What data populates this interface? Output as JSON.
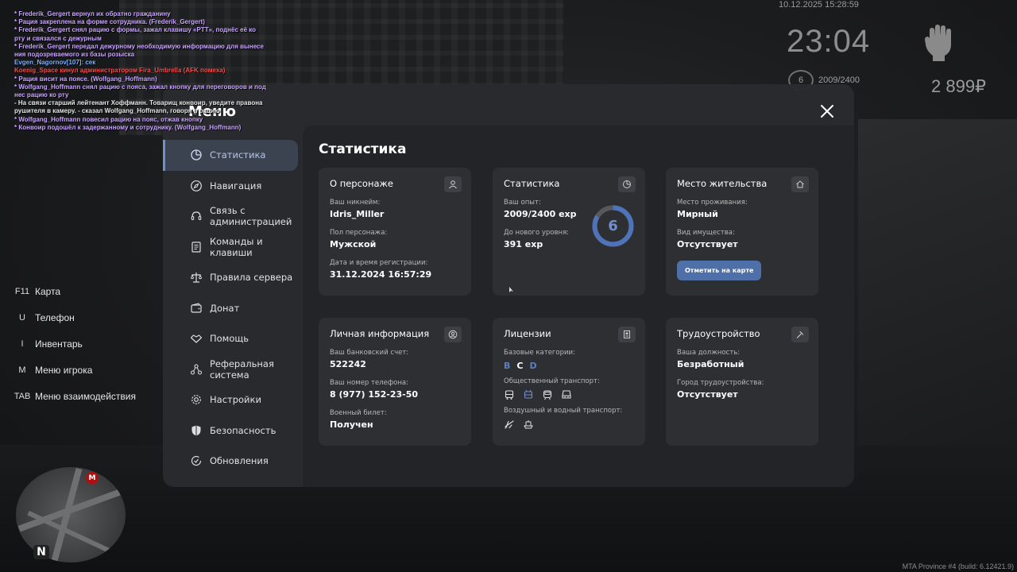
{
  "hud": {
    "date": "10.12.2025 15:28:59",
    "time": "23:04",
    "level": "6",
    "exp": "2009/2400",
    "money": "2 899₽"
  },
  "chat": [
    {
      "text": "* Frederik_Gergert вернул их обратно гражданину",
      "color": "purple"
    },
    {
      "text": "* Рация закреплена на форме сотрудника. (Frederik_Gergert)",
      "color": "purple"
    },
    {
      "text": "* Frederik_Gergert снял рацию с формы, зажал клавишу «PTT», поднёс её ко",
      "color": "purple"
    },
    {
      "text": "рту и связался с дежурным",
      "color": "purple"
    },
    {
      "text": "* Frederik_Gergert передал дежурному необходимую информацию для вынесе",
      "color": "purple"
    },
    {
      "text": "ния подозреваемого из базы розыска",
      "color": "purple"
    },
    {
      "text": "Evgen_Nagornov[107]: сек",
      "color": "blue"
    },
    {
      "text": "Koenig_Space кинул администратором Fira_Umbrella (AFK помеха)",
      "color": "red"
    },
    {
      "text": "* Рация висит на поясе. (Wolfgang_Hoffmann)",
      "color": "purple"
    },
    {
      "text": "* Wolfgang_Hoffmann снял рацию с пояса, зажал кнопку для переговоров и под",
      "color": "purple"
    },
    {
      "text": "нес рацию ко рту",
      "color": "purple"
    },
    {
      "text": "- На связи старший лейтенант Хоффманн. Товарищ конвоир, уведите правона",
      "color": "white"
    },
    {
      "text": "рушителя в камеру. - сказал Wolfgang_Hoffmann, говоря в рацию",
      "color": "white"
    },
    {
      "text": "* Wolfgang_Hoffmann повесил рацию на пояс, отжав кнопку",
      "color": "purple"
    },
    {
      "text": "* Конвоир подошёл к задержанному и сотруднику. (Wolfgang_Hoffmann)",
      "color": "purple"
    }
  ],
  "hotkeys": [
    {
      "key": "F11",
      "label": "Карта"
    },
    {
      "key": "U",
      "label": "Телефон"
    },
    {
      "key": "I",
      "label": "Инвентарь"
    },
    {
      "key": "M",
      "label": "Меню игрока"
    },
    {
      "key": "TAB",
      "label": "Меню взаимодействия"
    }
  ],
  "minimap": {
    "north": "N",
    "marker": "M"
  },
  "footer": "MTA Province #4 (build: 6.12421.9)",
  "menu": {
    "title": "Меню",
    "nav": [
      {
        "label": "Статистика",
        "icon": "pie-chart-icon",
        "active": true
      },
      {
        "label": "Навигация",
        "icon": "compass-icon"
      },
      {
        "label": "Связь с администрацией",
        "icon": "headset-icon"
      },
      {
        "label": "Команды и клавиши",
        "icon": "document-icon"
      },
      {
        "label": "Правила сервера",
        "icon": "scales-icon"
      },
      {
        "label": "Донат",
        "icon": "wallet-icon"
      },
      {
        "label": "Помощь",
        "icon": "handshake-icon"
      },
      {
        "label": "Реферальная система",
        "icon": "referral-icon"
      },
      {
        "label": "Настройки",
        "icon": "gear-icon"
      },
      {
        "label": "Безопасность",
        "icon": "shield-icon"
      },
      {
        "label": "Обновления",
        "icon": "update-icon"
      }
    ],
    "content_title": "Статистика",
    "cards": {
      "character": {
        "title": "О персонаже",
        "nickname_label": "Ваш никнейм:",
        "nickname": "Idris_Miller",
        "gender_label": "Пол персонажа:",
        "gender": "Мужской",
        "reg_label": "Дата и время регистрации:",
        "reg": "31.12.2024 16:57:29"
      },
      "stats": {
        "title": "Статистика",
        "exp_label": "Ваш опыт:",
        "exp": "2009/2400 exp",
        "next_label": "До нового уровня:",
        "next": "391 exp",
        "level": "6",
        "progress": 0.837
      },
      "residence": {
        "title": "Место жительства",
        "place_label": "Место проживания:",
        "place": "Мирный",
        "property_label": "Вид имущества:",
        "property": "Отсутствует",
        "button": "Отметить на карте"
      },
      "personal": {
        "title": "Личная информация",
        "bank_label": "Ваш банковский счет:",
        "bank": "522242",
        "phone_label": "Ваш номер телефона:",
        "phone": "8 (977) 152-23-50",
        "military_label": "Военный билет:",
        "military": "Получен"
      },
      "licenses": {
        "title": "Лицензии",
        "base_label": "Базовые категории:",
        "cat_b": "B",
        "cat_c": "C",
        "cat_d": "D",
        "public_label": "Общественный транспорт:",
        "air_label": "Воздушный и водный транспорт:"
      },
      "employment": {
        "title": "Трудоустройство",
        "position_label": "Ваша должность:",
        "position": "Безработный",
        "city_label": "Город трудоустройства:",
        "city": "Отсутствует"
      }
    }
  },
  "colors": {
    "accent": "#6f8fcf",
    "button": "#4f6fa8",
    "panel": "#2e2f33",
    "content_bg": "#232427",
    "menu_bg": "#2a2b2e"
  }
}
